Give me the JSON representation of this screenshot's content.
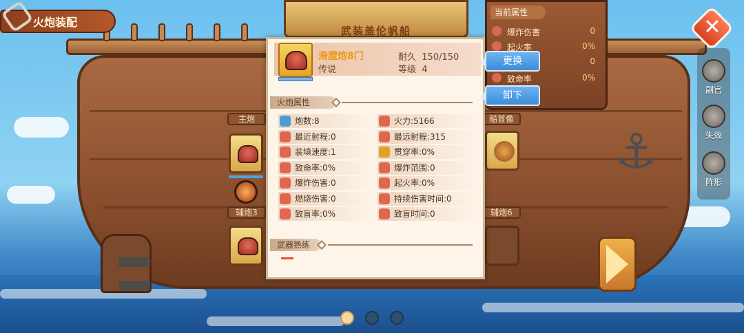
{
  "header": {
    "title": "火炮装配",
    "ship_name": "武装盖伦帆船"
  },
  "slots": {
    "main_label": "主炮",
    "aux3_label": "辅炮3",
    "aux6_label": "辅炮6",
    "figurehead_label": "船首像"
  },
  "current_attributes": {
    "title": "当前属性",
    "rows": [
      {
        "name": "爆炸伤害",
        "value": "0"
      },
      {
        "name": "起火率",
        "value": "0%"
      },
      {
        "name": "",
        "value": "0"
      },
      {
        "name": "致命率",
        "value": "0%"
      }
    ]
  },
  "side_menu": {
    "deputy": "副官",
    "disabled": "失效",
    "formation": "阵形"
  },
  "popup": {
    "item_name": "滑膛炮8门",
    "rarity": "传说",
    "durability_label": "耐久",
    "durability_value": "150/150",
    "level_label": "等级",
    "level_value": "4",
    "section_cannon": "火炮属性",
    "section_mastery": "武器熟练",
    "props_left": [
      {
        "text": "炮数:8",
        "icon": "cannon-count-icon",
        "color": "#4a9bd6"
      },
      {
        "text": "最近射程:0",
        "icon": "min-range-icon",
        "color": "#e0674f"
      },
      {
        "text": "装填速度:1",
        "icon": "reload-icon",
        "color": "#e0674f"
      },
      {
        "text": "致命率:0%",
        "icon": "skull-icon",
        "color": "#e0674f"
      },
      {
        "text": "爆炸伤害:0",
        "icon": "explosion-icon",
        "color": "#e0674f"
      },
      {
        "text": "燃烧伤害:0",
        "icon": "burn-icon",
        "color": "#e0674f"
      },
      {
        "text": "致盲率:0%",
        "icon": "blind-icon",
        "color": "#e0674f"
      }
    ],
    "props_right": [
      {
        "text": "火力:5166",
        "icon": "firepower-icon",
        "color": "#e0674f"
      },
      {
        "text": "最远射程:315",
        "icon": "max-range-icon",
        "color": "#e0674f"
      },
      {
        "text": "贯穿率:0%",
        "icon": "pierce-icon",
        "color": "#e2a125"
      },
      {
        "text": "爆炸范围:0",
        "icon": "blast-area-icon",
        "color": "#e0674f"
      },
      {
        "text": "起火率:0%",
        "icon": "fire-rate-icon",
        "color": "#e0674f"
      },
      {
        "text": "持续伤害时间:0",
        "icon": "dot-time-icon",
        "color": "#e0674f"
      },
      {
        "text": "致盲时间:0",
        "icon": "blind-time-icon",
        "color": "#e0674f"
      }
    ]
  },
  "actions": {
    "replace": "更换",
    "unequip": "卸下"
  },
  "pagination": {
    "count": 3,
    "active": 0
  }
}
